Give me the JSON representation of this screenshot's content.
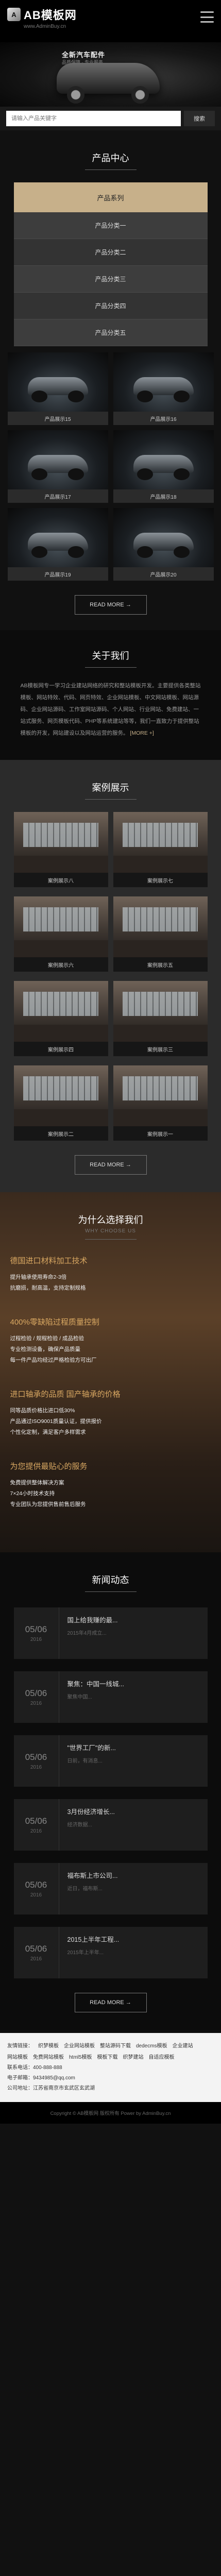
{
  "header": {
    "logo_mark": "A",
    "logo_title": "AB模板网",
    "logo_sub": "www.AdminBuy.cn"
  },
  "banner": {
    "headline": "全新汽车配件",
    "tag": "品质保障 · 专业服务"
  },
  "search": {
    "placeholder": "请输入产品关键字",
    "button_label": "搜索"
  },
  "products": {
    "title": "产品中心",
    "subtitle": "",
    "category_head": "产品系列",
    "categories": [
      "产品分类一",
      "产品分类二",
      "产品分类三",
      "产品分类四",
      "产品分类五"
    ],
    "items": [
      {
        "caption": "产品展示15"
      },
      {
        "caption": "产品展示16"
      },
      {
        "caption": "产品展示17"
      },
      {
        "caption": "产品展示18"
      },
      {
        "caption": "产品展示19"
      },
      {
        "caption": "产品展示20"
      }
    ],
    "more_label": "READ MORE →"
  },
  "about": {
    "title": "关于我们",
    "text": "AB模板网专一学习企业建站网络的研究和整站模板开发。主要提供各类整站模板、网站特效、代码、网页特效、企业网站模板、中文网站模板、网站源码、企业网站源码、工作室网站源码、个人网站、行业网站、免费建站、一站式服务、网页模板代码、PHP等系统建站等等，我们一直致力于提供整站模板的开发，网站建设以及网站运营的服务。",
    "more_link": "[MORE +]"
  },
  "cases": {
    "title": "案例展示",
    "items": [
      {
        "caption": "案例展示八"
      },
      {
        "caption": "案例展示七"
      },
      {
        "caption": "案例展示六"
      },
      {
        "caption": "案例展示五"
      },
      {
        "caption": "案例展示四"
      },
      {
        "caption": "案例展示三"
      },
      {
        "caption": "案例展示二"
      },
      {
        "caption": "案例展示一"
      }
    ],
    "more_label": "READ MORE →"
  },
  "why": {
    "title": "为什么选择我们",
    "subtitle": "WHY CHOOSE US",
    "items": [
      {
        "head": "德国进口材料加工技术",
        "lines": [
          "提升轴承使用寿命2-3倍",
          "抗磨损，耐高温，支持定制规格"
        ]
      },
      {
        "head": "400%零缺陷过程质量控制",
        "lines": [
          "过程检验 / 规程检验 / 成品检验",
          "专业检测设备，确保产品质量",
          "每一件产品均经过严格检验方可出厂"
        ]
      },
      {
        "head": "进口轴承的品质 国产轴承的价格",
        "lines": [
          "同等品质价格比进口低30%",
          "产品通过ISO9001质量认证，提供报价",
          "个性化定制，满足客户多样需求"
        ]
      },
      {
        "head": "为您提供最贴心的服务",
        "lines": [
          "免费提供整体解决方案",
          "7×24小时技术支持",
          "专业团队为您提供售前售后服务"
        ]
      }
    ]
  },
  "news": {
    "title": "新闻动态",
    "items": [
      {
        "day": "05/06",
        "year": "2016",
        "title": "国上给我赚的最...",
        "desc": "2015年4月成立..."
      },
      {
        "day": "05/06",
        "year": "2016",
        "title": "聚焦：中国一线城...",
        "desc": "聚焦中国..."
      },
      {
        "day": "05/06",
        "year": "2016",
        "title": "\"世界工厂\"的新...",
        "desc": "日前，有消息..."
      },
      {
        "day": "05/06",
        "year": "2016",
        "title": "3月份经济增长...",
        "desc": "经济数据..."
      },
      {
        "day": "05/06",
        "year": "2016",
        "title": "福布斯上市公司...",
        "desc": "近日，福布斯..."
      },
      {
        "day": "05/06",
        "year": "2016",
        "title": "2015上半年工程...",
        "desc": "2015年上半年..."
      }
    ],
    "more_label": "READ MORE →"
  },
  "footer": {
    "links": [
      "友情链接：",
      "织梦模板",
      "企业网站模板",
      "整站源码下载",
      "dedecms模板",
      "企业建站",
      "网站模板",
      "免费网站模板",
      "html5模板",
      "模板下载",
      "织梦建站",
      "自适应模板"
    ],
    "contact_lines": [
      "联系电话：400-888-888",
      "电子邮箱：9434985@qq.com",
      "公司地址：江苏省南京市玄武区玄武湖"
    ],
    "copyright": "Copyright © AB模板网 版权所有 Power by AdminBuy.cn"
  },
  "colors": {
    "accent": "#c7b08a",
    "why_heading": "#d9a862"
  }
}
